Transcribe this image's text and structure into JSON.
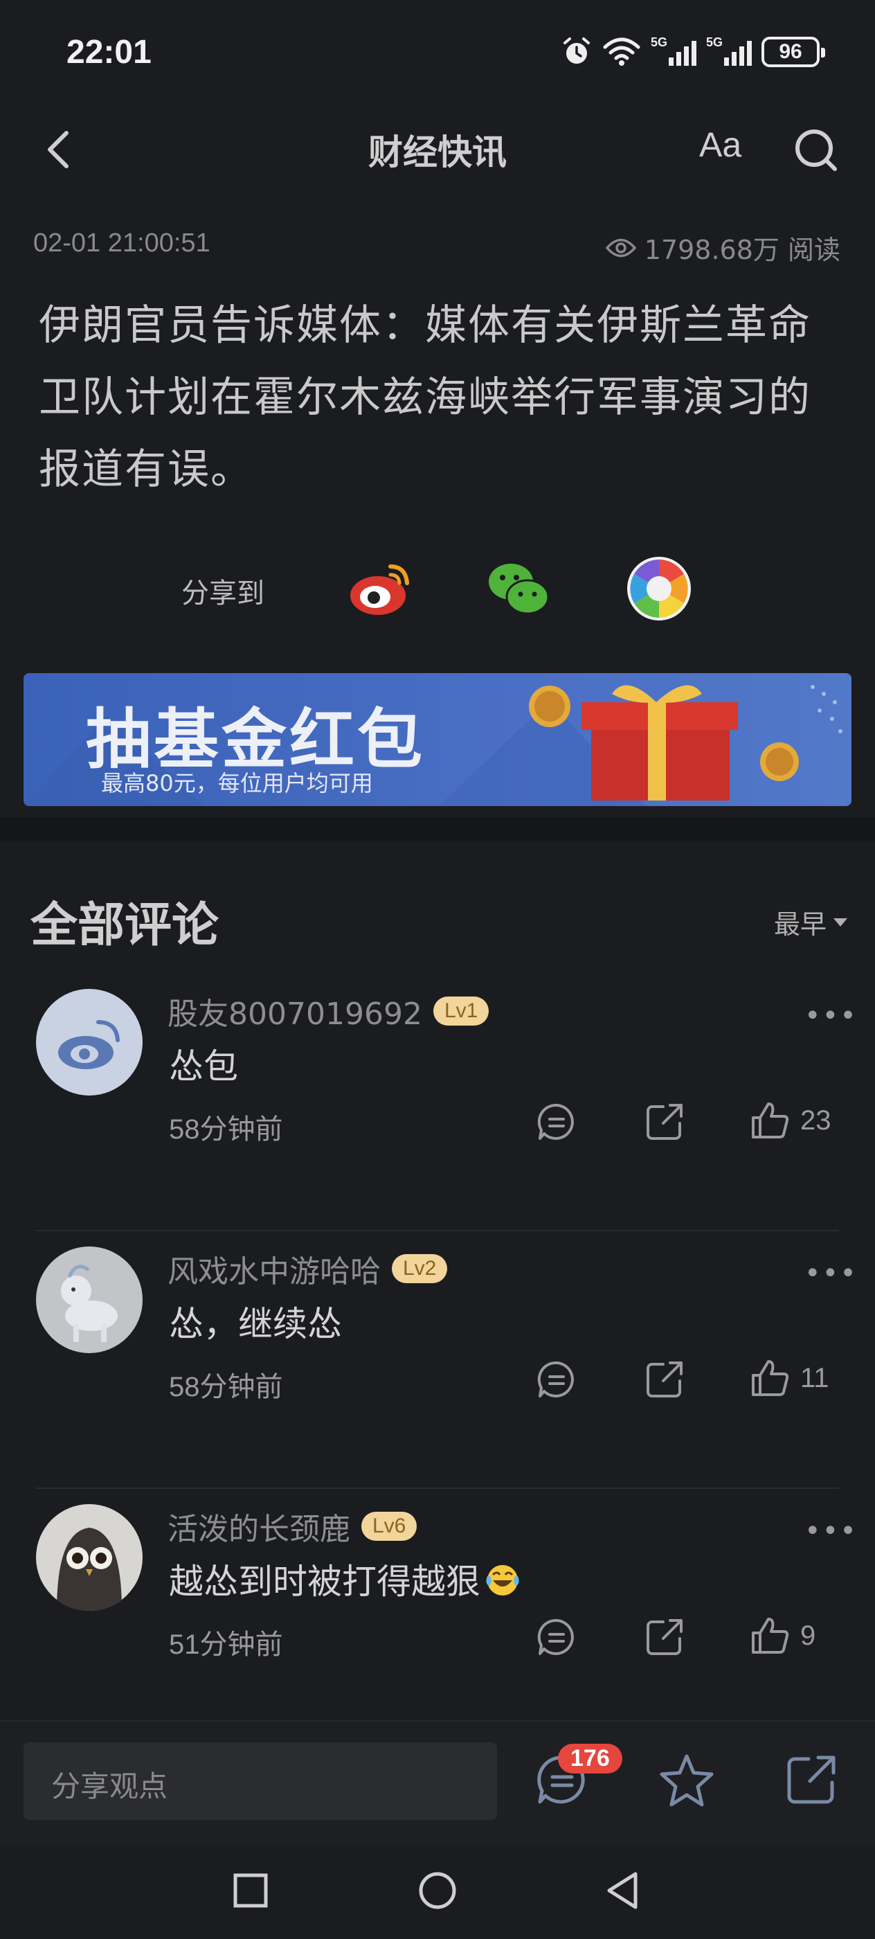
{
  "status": {
    "time": "22:01",
    "battery": "96",
    "signal1": "5G",
    "signal2": "5G"
  },
  "nav": {
    "title": "财经快讯",
    "font_label": "Aa"
  },
  "article": {
    "datetime": "02-01 21:00:51",
    "views": "1798.68万 阅读",
    "headline": "伊朗官员告诉媒体：媒体有关伊斯兰革命卫队计划在霍尔木兹海峡举行军事演习的报道有误。"
  },
  "share": {
    "label": "分享到"
  },
  "banner": {
    "title": "抽基金红包",
    "subtitle": "最高80元，每位用户均可用"
  },
  "comments": {
    "title": "全部评论",
    "sort": "最早",
    "items": [
      {
        "user": "股友8007019692",
        "level": "Lv1",
        "text": "怂包",
        "time": "58分钟前",
        "likes": "23"
      },
      {
        "user": "风戏水中游哈哈",
        "level": "Lv2",
        "text": "怂，继续怂",
        "time": "58分钟前",
        "likes": "11"
      },
      {
        "user": "活泼的长颈鹿",
        "level": "Lv6",
        "text": "越怂到时被打得越狠",
        "time": "51分钟前",
        "likes": "9"
      }
    ]
  },
  "bottom": {
    "input_placeholder": "分享观点",
    "comment_count": "176"
  },
  "colors": {
    "background": "#1b1c1f",
    "badge": "#e5463e",
    "level_badge": "#f2d59b",
    "banner": "#4a6fc4"
  }
}
